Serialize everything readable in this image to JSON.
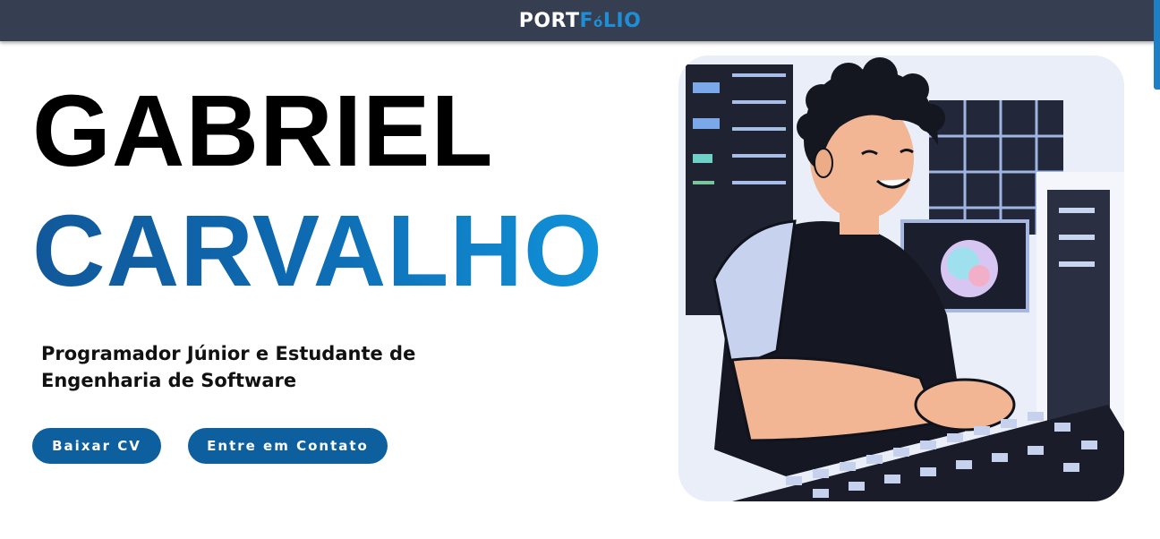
{
  "header": {
    "logo_part1": "PORT",
    "logo_part2": "F",
    "logo_part3": "ó",
    "logo_part4": "LIO"
  },
  "hero": {
    "first_name": "GABRIEL",
    "last_name": "CARVALHO",
    "subtitle": "Programador Júnior e Estudante de Engenharia de Software",
    "buttons": {
      "download_cv": "Baixar CV",
      "contact": "Entre em Contato"
    }
  },
  "colors": {
    "header_bg": "#353f51",
    "accent": "#0e5f9e",
    "accent_light": "#1192d9"
  },
  "illustration": {
    "icon": "developer-at-keyboard-illustration"
  }
}
